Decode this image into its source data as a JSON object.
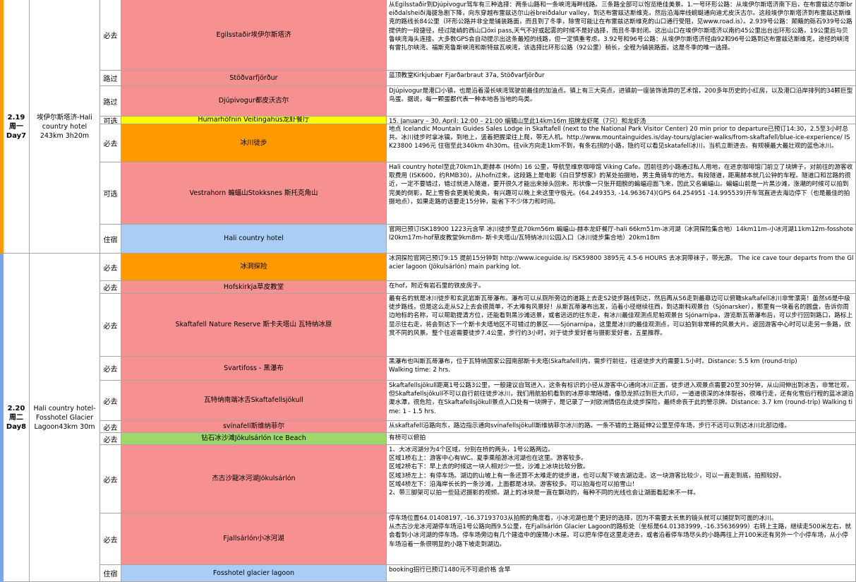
{
  "colors": {
    "red": "#f79191",
    "orange": "#ff9900",
    "yellow": "#ffff00",
    "blue": "#a9cdf5",
    "green": "#9ed86a"
  },
  "days": [
    {
      "date": "2.19",
      "weekday": "周一",
      "day": "Day7",
      "route": "埃伊尔斯塔济-Hali country hotel 243km 3h20m",
      "rows": [
        {
          "tag": "必去",
          "place": "Egilsstaðir埃伊尔斯塔济",
          "color": "red",
          "desc": [
            "从Egilsstaðir到Djúpivogur驾车有三种选择：两条山路和一条峡湾海畔线路。三条路全部可以饱览绝佳美景。1.一号环形公路：从埃伊尔斯塔济南下后，在布雷兹达尔斯breiðdalsheiði海拔急剧下降，向东穿越布雷兹达尔山谷breiðdalur valley，到达布雷兹达斯维克，然后沿海岸线蜿蜒通向迪尤皮沃古尔。这段埃伊尔斯塔济到布雷兹达斯维克的路线长84公里（环形公路并非全是铺装路面，而且到了冬季，除雪可能让在布雷兹达斯维克的山口通行受阻，见www.road.is）。2.939号公路：颠簸的砾石939号公路提供的一段捷径，经过陡峭的西山口öxi pass,天气不好或起雾的时候不是好选择，而且冬季封闭。这出山口在埃伊尔斯塔济以南约45公里出台出环形公路，19公里后与贝鲁峡湾海头连接。大多数GPS会自动提示出这条最短的线路，但一定慎重考虑。3.92号和96号公路：从埃伊尔斯塔济经由92和96号公路到达布雷兹达斯维克，途经的峡湾有雷扎尔峡湾、福斯克鲁斯峡湾和斯特兹瓦峡湾，该选择比环形公路（92公里）稍长，全程为铺装路面，这是冬季的唯一选择。"
          ]
        },
        {
          "tag": "路过",
          "place": "Stöðvarfjörður",
          "color": "red",
          "desc": [
            "蓝顶教堂Kirkjubær  Fjarðarbraut 37a, Stöðvarfjörður"
          ]
        },
        {
          "tag": "路过",
          "place": "Djúpivogur都皮沃古尔",
          "color": "red",
          "desc": [
            "Djúpivogur是港口小镇，也是沿着漫长峡湾驾驶前最佳的加油点。镇上有三大亮点，进镇前一座装饰诡异的艺术馆，200多年历史的小红房，以及港口沿岸排列的34颗巨型鸟蛋。据说，每一颗蛋都代表一种本地各当地的鸟类。"
          ]
        },
        {
          "tag": "可选",
          "place": "Humarhöfnin Veitingahús龙虾餐厅",
          "color": "yellow",
          "desc": [
            "15. January –  30. April: 12:00 – 21:00 编辑山至此14km16m 招牌龙虾尾（7只）和龙虾汤"
          ]
        },
        {
          "tag": "必去",
          "place": "冰川徒步",
          "color": "orange",
          "desc": [
            "地点 Icelandic Mountain Guides Sales Lodge in Skaftafell (next to the National Park Visitor Center) 20 min prior to departure已预订14:30，2.5至3小时总共。冰川徒步时拿冰镐，到地上，竖着把握梁往上爬，带无人机。http://www.mountainguides.is/day-tours/glacier-walks/from-skaftafell/blue-ice-experience/ ISK23800 1496元 住宿至此340km 4h30m。往vik方向走1km不到，有条右拐的小路，隐约可以看见skatafell冰川，当机立断进去。有规模最大最壮观的蓝色冰川。"
          ]
        },
        {
          "tag": "可选",
          "place": "Vestrahorn 蝙蝠山Stokksnes 斯托克角山",
          "color": "red",
          "desc": [
            "Hali country hotel至此70km1h,距赫本 (Höfn)  16 公里，导航至维京咖啡馆 Viking Cafe。因前往的小路通过私人用地，在进京咖啡馆门前立了块牌子，对前往的游客收取费用 (ISK600，约RMB30)，从hofn过来，这段路上是电影《白日梦想家》的某处拍摄地，男主角骑车的地方。有段隧道，距离赫本就几公钟的车程。隧道口和岔路的很近，一定不要错过，错过就进入隧道，要开很久才能出来掉头回来。形状像一只张开翅膀的蝙蝠迎面飞来，因此又名蝙蝠山。蝙蝠山前是一片黑沙滩，涨潮的时候可以拍到完美的倒影，配上雪昏会更美轮美奂，有兴趣可以晚上来这里守极光。(64.249353, -14.963674)(GPS 64.254951 -14.995539)开车驾直进去海边停下（也是最佳的拍摄地点），如果走路的话要走15分钟，能省下不少体力和时间。"
          ]
        },
        {
          "tag": "住宿",
          "place": "Hali country hotel",
          "color": "blue",
          "desc": [
            "官网已预订ISK18900  1223元含早 冰川徒步至此70km56m  蝙蝠山-赫本龙虾餐厅-hali 66km51m-冰河湖（冰洞探险集合地）14km11m-小冰河湖11km12m-fosshotel20km17m-hof草皮教堂9km8m- 斯卡夫塔山/瓦特纳冰川公园入口（冰川徒步集合地）20km18m"
          ]
        }
      ]
    },
    {
      "date": "2.20",
      "weekday": "周二",
      "day": "Day8",
      "route": "Hali country hotel-Fosshotel Glacier Lagoon43km 30m",
      "rows": [
        {
          "tag": "必去",
          "place": "冰洞探险",
          "color": "orange",
          "desc": [
            "冰洞探险官网已预订9:15 提前15分钟到 http://www.iceguide.is/ ISK59800 3895元 4.5-6 HOURS 去冰洞带袜子，带光源。 The ice cave tour departs from the Glacier lagoon (Jökulsárlón) main parking lot."
          ]
        },
        {
          "tag": "必去",
          "place": "Hofskirkja草皮教堂",
          "color": "red",
          "desc": [
            "在hof，附近有岩石里的铁皮房子。"
          ]
        },
        {
          "tag": "必去",
          "place": "Skaftafell Nature Reserve 斯卡夫塔山 瓦特纳冰原",
          "color": "red",
          "desc": [
            "最有名的就是冰川徒步和玄武岩斯瓦蒂瀑布。瀑布可以从厕所旁边的道路上去走S2徒步路线到达，然后再从S6走到最靠边可以俯瞰skaftafell冰川非常漂亮！虽然s6是中级徒步路线，但是这么走从S2上去会很简单，不太难有风景好！从斯瓦蒂瀑布出发，沿着小径继续往西，到达斯科观景台（Sjónarsker），那里有一块着名的圆盘，告诉你周边地标的名称，可以帮助提清方位，还能看到黑沙滩远景，或者远远的往东走，有冰川最佳观测点尼帕观景台 Sjónarnípa，游览斯瓦蒂瀑布后，可以步行回到路口，路标上显示往右走，将会到达下一个斯卡夫塔地区不可错过的景区——Sjónarnípa，这里是冰川的最佳观测点，可以拍到非常棒的风景大片。返回游客中心时可以走另一条路，欣赏不同的风景。整个往返需要徒步7.4公里，步行约3小时，对于徒步爱好者与摄影爱好者，五星推荐。"
          ]
        },
        {
          "tag": "必去",
          "place": "Svartifoss - 黑瀑布",
          "color": "red",
          "desc": [
            "黑瀑布也叫斯瓦蒂瀑布，位于瓦特纳国家公园南部斯卡夫塔(Skaftafell)内，需步行前往，往返徒步大约需要1.5小时。Distance: 5.5 km (round-trip)",
            "Walking time: 2 hrs."
          ]
        },
        {
          "tag": "必去",
          "place": "瓦特纳南端冰舌Skaftafellsjökull",
          "color": "red",
          "desc": [
            "Skaftafellsjökull距离1号公路3公里，一般建议自驾进入，这条有标识的小径从游客中心通向冰川正面，徒步进入观景点需要20至30分钟，从山间伸出到冰舌，非常壮观，但Skaftafellsjökull不可以自行前往徒步冰川，我们用航拍机看到的冰原非常随晴，像恐龙抓过到巨大爪印，一道道很深的冰体裂谷，很难行走，还有化雪后行程的蓝冰湖泊渠水潭，很危险，在Skaftafellsjökull景点入口处有一块牌子，是记录了一对欧洲情侣在此徒步探险，最终命丧于此的警示牌。Distance: 3.7 km (round-trip)  Walking time: 1 - 1.5 hrs."
          ]
        },
        {
          "tag": "必去",
          "place": "svínafell斯维纳菲尔",
          "color": "red",
          "desc": [
            "从skaftafell沿路向东，路边指示通向svínafellsjökull斯维纳菲尔冰川的路。一条不错的土路延伸2公里至停车场，步行不远可以到达冰川北部边缘。"
          ]
        },
        {
          "tag": "必去",
          "place": "钻石冰沙滩Jökulsárlón Ice Beach",
          "color": "green",
          "desc": [
            "有桥可以俯拍"
          ]
        },
        {
          "tag": "必去",
          "place": "杰古沙龍冰河湖Jökulsárlón",
          "color": "red",
          "desc": [
            "1、大冰河湖分为4个区域，分别在桥的两头，1号公路两边。",
            "区域1桥右上：游客中心有WC。夏季乘船游冰河湖也在这里。游客较多。",
            "区域2桥右下：早上去的时候这一块人相对少一些，沙滩上冰块比较分散。",
            "区域3桥左上：有停车场。湖边的山坡上有一条还算不太难走的徒步道，也可以爬下坡去湖边走。这一块游客比较少，可以一直走到底，拍照较好。",
            "区域4桥左下：沿海岸长长的一条沙滩，上面都是冰块。游客较多。可以拍海也可以拍雪山！",
            "2、带三脚架可以拍一些延迟摄影的视频。湖上的冰块是一直在飘动的，每种不同的光线也会让湖面看起来不一样。"
          ]
        },
        {
          "tag": "必去",
          "place": "Fjallsárlón小冰河湖",
          "color": "red",
          "desc": [
            "停车场位置64.01408197, -16.37193703从拍照的角度看，小冰河湖也是个更好的选择，因为不需要太长焦的镜头就可以捕捉到可面的冰川。",
            "从杰古沙龙冰河湖停车场沿1号公路向西9.5公里，在Fjallsárlón Glacier Lagoon的路标处（坐标是64.01383999, -16.35636999）右转上主路，继续走500米左右，就会看到小冰河湖的停车场。停车场旁边有几个建造中的废隔小木屋。可以把车停在这里走进去，或者沿着停车场尽头的小路再往上开100米还有另外一个小停车场，从小停车场沿着一条很明显的小路下坡走到湖边。"
          ]
        },
        {
          "tag": "住宿",
          "place": "Fosshotel glacier lagoon",
          "color": "blue",
          "desc": [
            "booking招行已预订1480元不可退价格 含早"
          ]
        }
      ]
    }
  ]
}
